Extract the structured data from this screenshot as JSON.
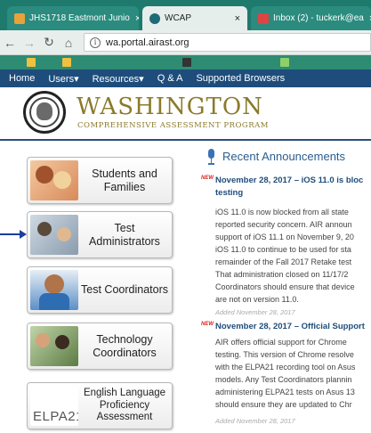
{
  "browser": {
    "tabs": [
      {
        "title": "JHS1718 Eastmont Junio",
        "close": "×",
        "icon": "orange-doc-icon"
      },
      {
        "title": "WCAP",
        "close": "×",
        "icon": "teal-globe-icon"
      },
      {
        "title": "Inbox (2) - tuckerk@ea",
        "close": "×",
        "icon": "mail-icon"
      }
    ],
    "url": "wa.portal.airast.org"
  },
  "site_nav": {
    "items": [
      "Home",
      "Users▾",
      "Resources▾",
      "Q & A",
      "Supported Browsers"
    ]
  },
  "header": {
    "title": "WASHINGTON",
    "subtitle": "COMPREHENSIVE ASSESSMENT PROGRAM"
  },
  "roles": [
    {
      "label": "Students and Families"
    },
    {
      "label": "Test Administrators"
    },
    {
      "label": "Test Coordinators"
    },
    {
      "label": "Technology Coordinators"
    },
    {
      "label": "English Language Proficiency Assessment",
      "logo": "ELPA21"
    }
  ],
  "announcements": {
    "heading": "Recent Announcements",
    "badge": "NEW",
    "items": [
      {
        "title_line1": "November 28, 2017 – iOS 11.0 is bloc",
        "title_line2": "testing",
        "body": [
          "iOS 11.0 is now blocked from all state",
          "reported security concern. AIR announ",
          "support of iOS 11.1 on November 9, 20",
          "iOS 11.0 to continue to be used for sta",
          "remainder of the Fall 2017 Retake test",
          "That administration closed on 11/17/2",
          "Coordinators should ensure that device",
          "are not on version 11.0."
        ],
        "date": "Added November 28, 2017"
      },
      {
        "title_line1": "November 28, 2017 – Official Support",
        "body": [
          "AIR offers official support for Chrome",
          "testing. This version of Chrome resolve",
          "with the ELPA21 recording tool on Asus",
          "models. Any Test Coordinators plannin",
          "administering ELPA21 tests on Asus 13",
          "should ensure they are updated to Chr"
        ],
        "date": "Added November 28, 2017"
      }
    ]
  }
}
